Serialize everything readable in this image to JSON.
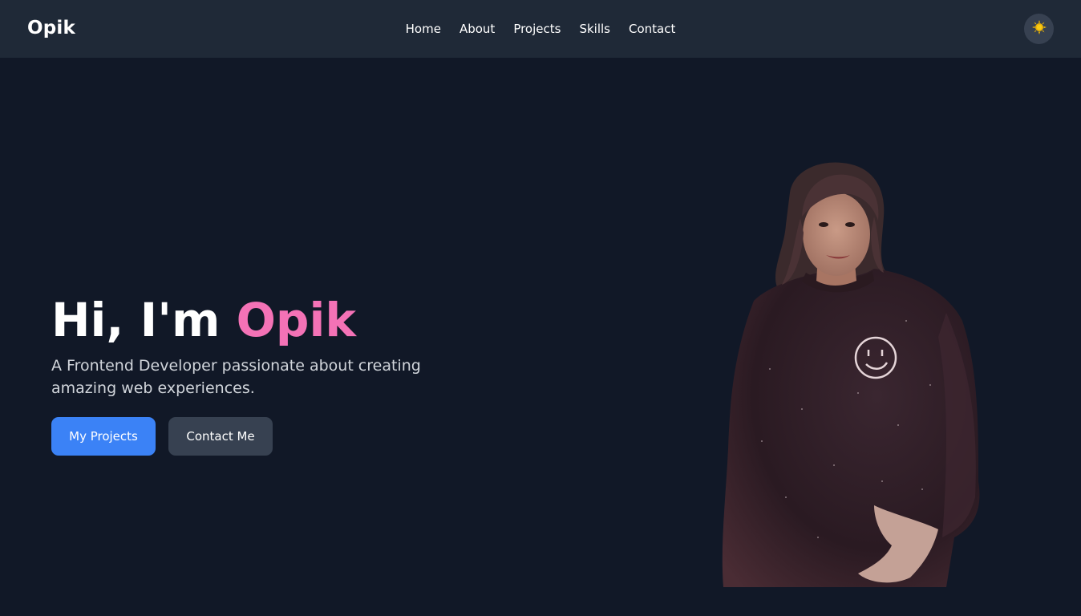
{
  "nav": {
    "brand": "Opik",
    "links": [
      "Home",
      "About",
      "Projects",
      "Skills",
      "Contact"
    ],
    "theme_toggle_icon": "sun-icon"
  },
  "hero": {
    "greeting": "Hi, I'm ",
    "name": "Opik",
    "subtitle": "A Frontend Developer passionate about creating amazing web experiences.",
    "primary_button": "My Projects",
    "secondary_button": "Contact Me",
    "portrait_icon": "profile-photo"
  },
  "colors": {
    "background": "#111827",
    "navbar": "#1f2937",
    "accent_pink": "#f472b6",
    "primary_blue": "#3b82f6",
    "secondary_gray": "#374151"
  }
}
